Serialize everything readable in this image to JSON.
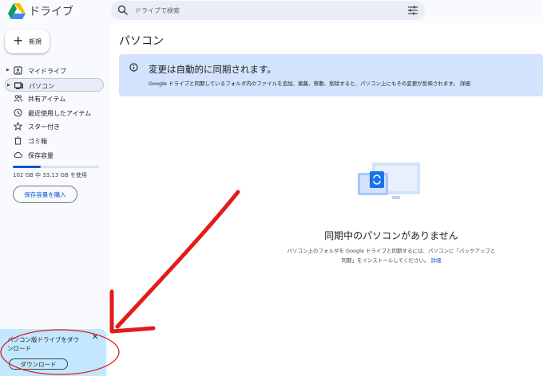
{
  "app": {
    "name": "ドライブ"
  },
  "search": {
    "placeholder": "ドライブで検索"
  },
  "new_button": {
    "label": "新規"
  },
  "sidebar": {
    "items": [
      {
        "label": "マイドライブ",
        "icon": "my-drive-icon",
        "expandable": true
      },
      {
        "label": "パソコン",
        "icon": "computer-icon",
        "expandable": true,
        "active": true
      },
      {
        "label": "共有アイテム",
        "icon": "shared-icon"
      },
      {
        "label": "最近使用したアイテム",
        "icon": "clock-icon"
      },
      {
        "label": "スター付き",
        "icon": "star-icon"
      },
      {
        "label": "ゴミ箱",
        "icon": "trash-icon"
      },
      {
        "label": "保存容量",
        "icon": "cloud-icon"
      }
    ]
  },
  "storage": {
    "text": "102 GB 中 33.13 GB を使用",
    "used_fraction": 0.32,
    "buy_label": "保存容量を購入"
  },
  "main": {
    "title": "パソコン",
    "banner": {
      "heading": "変更は自動的に同期されます。",
      "body": "Google ドライブと同期しているフォルダ内のファイルを追加、編集、移動、削除すると、パソコン上にもその変更が反映されます。",
      "link": "詳細"
    },
    "empty_state": {
      "title": "同期中のパソコンがありません",
      "line1": "パソコン上のフォルダを Google ドライブと同期するには、パソコンに「バックアップと",
      "line2": "同期」をインストールしてください。",
      "link": "詳細"
    }
  },
  "popup": {
    "line1": "パソコン版ドライブをダウ",
    "line2": "ンロード",
    "close_glyph": "✕",
    "button": "ダウンロード"
  },
  "colors": {
    "accent": "#0b57d0",
    "banner_bg": "#d3e3fd",
    "popup_bg": "#c2e7ff",
    "annotation": "#e31b1b"
  }
}
